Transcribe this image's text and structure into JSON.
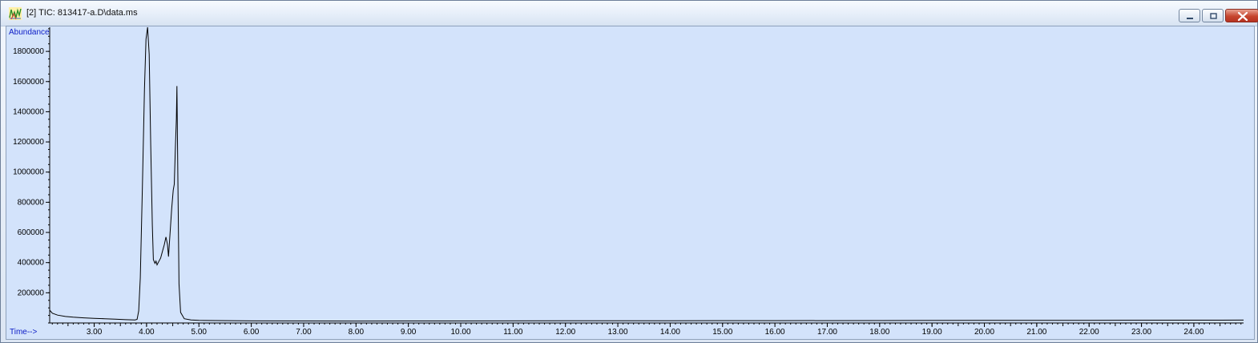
{
  "window": {
    "title": "[2] TIC: 813417-a.D\\data.ms",
    "controls": [
      "minimize",
      "maximize",
      "close"
    ]
  },
  "chart_data": {
    "type": "line",
    "ylabel": "Abundance",
    "xlabel": "Time-->",
    "x_ticks": [
      3.0,
      4.0,
      5.0,
      6.0,
      7.0,
      8.0,
      9.0,
      10.0,
      11.0,
      12.0,
      13.0,
      14.0,
      15.0,
      16.0,
      17.0,
      18.0,
      19.0,
      20.0,
      21.0,
      22.0,
      23.0,
      24.0
    ],
    "x_tick_labels": [
      "3.00",
      "4.00",
      "5.00",
      "6.00",
      "7.00",
      "8.00",
      "9.00",
      "10.00",
      "11.00",
      "12.00",
      "13.00",
      "14.00",
      "15.00",
      "16.00",
      "17.00",
      "18.00",
      "19.00",
      "20.00",
      "21.00",
      "22.00",
      "23.00",
      "24.00"
    ],
    "y_ticks": [
      200000,
      400000,
      600000,
      800000,
      1000000,
      1200000,
      1400000,
      1600000,
      1800000
    ],
    "y_tick_labels": [
      "200000",
      "400000",
      "600000",
      "800000",
      "1000000",
      "1200000",
      "1400000",
      "1600000",
      "1800000"
    ],
    "xlim": [
      2.15,
      24.95
    ],
    "ylim": [
      0,
      1960000
    ],
    "grid": false,
    "series": [
      {
        "color": "#000000",
        "points": [
          [
            2.15,
            85000
          ],
          [
            2.2,
            65000
          ],
          [
            2.3,
            52000
          ],
          [
            2.45,
            43000
          ],
          [
            2.6,
            38000
          ],
          [
            2.8,
            34000
          ],
          [
            3.0,
            31000
          ],
          [
            3.2,
            28000
          ],
          [
            3.4,
            25000
          ],
          [
            3.6,
            22000
          ],
          [
            3.78,
            20000
          ],
          [
            3.82,
            24000
          ],
          [
            3.85,
            80000
          ],
          [
            3.88,
            300000
          ],
          [
            3.92,
            900000
          ],
          [
            3.96,
            1550000
          ],
          [
            3.99,
            1880000
          ],
          [
            4.02,
            1960000
          ],
          [
            4.05,
            1780000
          ],
          [
            4.08,
            1180000
          ],
          [
            4.11,
            650000
          ],
          [
            4.13,
            420000
          ],
          [
            4.16,
            395000
          ],
          [
            4.18,
            410000
          ],
          [
            4.2,
            385000
          ],
          [
            4.23,
            405000
          ],
          [
            4.27,
            430000
          ],
          [
            4.3,
            470000
          ],
          [
            4.34,
            520000
          ],
          [
            4.37,
            570000
          ],
          [
            4.4,
            520000
          ],
          [
            4.42,
            440000
          ],
          [
            4.45,
            600000
          ],
          [
            4.48,
            760000
          ],
          [
            4.51,
            880000
          ],
          [
            4.53,
            920000
          ],
          [
            4.55,
            1150000
          ],
          [
            4.57,
            1350000
          ],
          [
            4.58,
            1570000
          ],
          [
            4.6,
            900000
          ],
          [
            4.62,
            260000
          ],
          [
            4.65,
            70000
          ],
          [
            4.72,
            28000
          ],
          [
            4.85,
            20000
          ],
          [
            5.0,
            17000
          ],
          [
            6.0,
            14000
          ],
          [
            8.0,
            13000
          ],
          [
            10.0,
            13500
          ],
          [
            12.0,
            14500
          ],
          [
            14.0,
            15000
          ],
          [
            16.0,
            15500
          ],
          [
            18.0,
            16000
          ],
          [
            20.0,
            17000
          ],
          [
            22.0,
            17500
          ],
          [
            24.0,
            18500
          ],
          [
            24.95,
            19000
          ]
        ]
      }
    ]
  }
}
